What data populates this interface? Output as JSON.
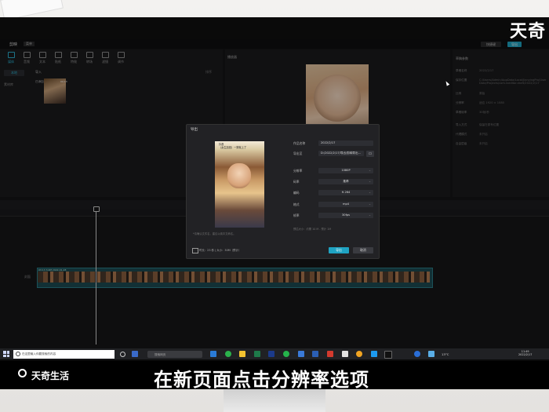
{
  "watermark": "天奇",
  "app": {
    "title": "剪映",
    "menu": "菜单",
    "shortcut": "快捷键",
    "export": "导出",
    "toolbar": [
      "媒体",
      "音频",
      "文本",
      "贴纸",
      "特效",
      "转场",
      "滤镜",
      "调节"
    ],
    "sidebar": {
      "local": "本地",
      "library": "素材库"
    },
    "media": {
      "import_label": "导入",
      "clip_duration": "00:13",
      "clip_name": "已添加",
      "sort": "排序"
    },
    "player_title": "播放器",
    "details": {
      "title": "草稿参数",
      "rows": [
        {
          "label": "草稿名称",
          "value": "2022/2/17"
        },
        {
          "label": "保存位置",
          "value": "C:/Users/Admin/AppData/Local/JianyingPro/User Data/Projects/com.lveditor.draft/2022/2/17"
        },
        {
          "label": "比例",
          "value": "原始"
        },
        {
          "label": "分辨率",
          "value": "适应 1920 × 1080"
        },
        {
          "label": "草稿帧率",
          "value": "30帧/秒"
        },
        {
          "label": "导入方式",
          "value": "保留在原有位置"
        },
        {
          "label": "代理模式",
          "value": "未开启"
        },
        {
          "label": "自由层级",
          "value": "未开启"
        }
      ]
    },
    "timeline": {
      "track_label": "封面",
      "clip_label": "03:13 3.0M  2022-01-28"
    }
  },
  "dialog": {
    "title": "导出",
    "cover_text": "抖音\n（女生加班）一穿就上了",
    "cover_note": "*请确认文件名，建议以纯中文命名。",
    "labels": {
      "name": "作品名称",
      "path": "导出至",
      "resolution": "分辨率",
      "bitrate": "码率",
      "codec": "编码",
      "format": "格式",
      "fps": "帧率"
    },
    "values": {
      "name": "2022/2/17",
      "path": "D:/2022/2/17/导出/剪映导出...",
      "resolution": "1080P",
      "bitrate": "推荐",
      "codec": "H.264",
      "format": "mp4",
      "fps": "30fps"
    },
    "estimate": "预估大小：约需 10 M - 预计 1M",
    "duration_info": "时长：23 秒 | 大小：30M（预计）",
    "export_btn": "导出",
    "cancel_btn": "取消"
  },
  "taskbar": {
    "search_placeholder": "在这里输入你要搜索的内容",
    "search2": "搜索网页",
    "temp": "13°C",
    "time": "11:49",
    "date": "2022/2/17"
  },
  "caption": {
    "brand": "天奇生活",
    "text": "在新页面点击分辨率选项"
  },
  "colors": {
    "accent": "#1fa3c2",
    "panel": "#1b1b1d"
  }
}
